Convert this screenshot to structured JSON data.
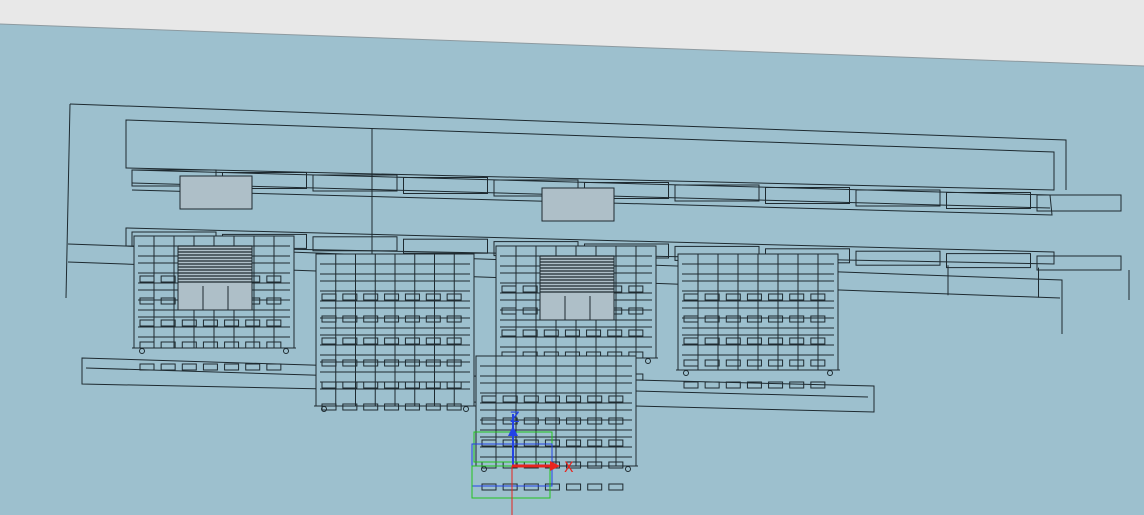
{
  "viewport": {
    "background_color": "#9dc0ce",
    "top_bar_color": "#e8e8e8",
    "line_color": "#1e2a30",
    "panel_fill": "#aebfc8"
  },
  "axes": {
    "x": {
      "label": "X",
      "color": "#e8241e"
    },
    "y": {
      "label": "",
      "color": "#2f7a24"
    },
    "z": {
      "label": "Z",
      "color": "#2343e6"
    }
  },
  "gizmo_boxes": {
    "colors": [
      "#22c41e",
      "#2343e6"
    ]
  }
}
